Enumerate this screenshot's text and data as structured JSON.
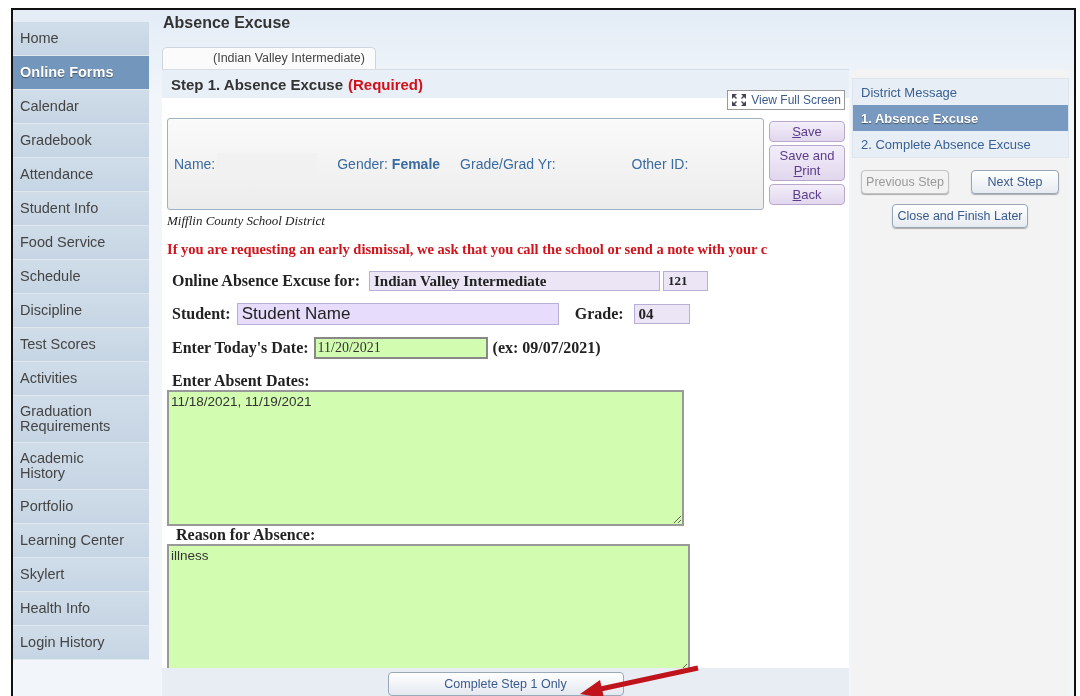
{
  "sidebar": {
    "items": [
      {
        "label": "Home",
        "selected": false
      },
      {
        "label": "Online Forms",
        "selected": true
      },
      {
        "label": "Calendar",
        "selected": false
      },
      {
        "label": "Gradebook",
        "selected": false
      },
      {
        "label": "Attendance",
        "selected": false
      },
      {
        "label": "Student Info",
        "selected": false
      },
      {
        "label": "Food Service",
        "selected": false
      },
      {
        "label": "Schedule",
        "selected": false
      },
      {
        "label": "Discipline",
        "selected": false
      },
      {
        "label": "Test Scores",
        "selected": false
      },
      {
        "label": "Activities",
        "selected": false
      },
      {
        "label": "Graduation Requirements",
        "selected": false
      },
      {
        "label": "Academic History",
        "selected": false
      },
      {
        "label": "Portfolio",
        "selected": false
      },
      {
        "label": "Learning Center",
        "selected": false
      },
      {
        "label": "Skylert",
        "selected": false
      },
      {
        "label": "Health Info",
        "selected": false
      },
      {
        "label": "Login History",
        "selected": false
      }
    ]
  },
  "page_title": "Absence Excuse",
  "tabs": [
    {
      "label": "(Indian Valley Intermediate)",
      "selected": true
    }
  ],
  "step": {
    "title": "Step 1. Absence Excuse",
    "required": "(Required)"
  },
  "view_full_screen": "View Full Screen",
  "student_info": {
    "name_label": "Name:",
    "gender_label": "Gender:",
    "gender": "Female",
    "grade_label": "Grade/Grad Yr:",
    "other_id_label": "Other ID:"
  },
  "actions": [
    {
      "key": "S",
      "after": "ave"
    },
    {
      "before": "Save and ",
      "key": "P",
      "after": "rint"
    },
    {
      "key": "B",
      "after": "ack"
    }
  ],
  "district": "Mifflin County School District",
  "notice": "If you are requesting an early dismissal, we ask that you call the school or send a note with your c",
  "form": {
    "school_label": "Online Absence Excuse for:",
    "school": "Indian Valley Intermediate",
    "school_code": "121",
    "student_label": "Student:",
    "student": "Student Name",
    "grade_label": "Grade:",
    "grade": "04",
    "date_label": "Enter Today's Date:",
    "date": "11/20/2021",
    "date_hint": "(ex: 09/07/2021)",
    "absent_label": "Enter Absent Dates:",
    "absent_dates": "11/18/2021, 11/19/2021",
    "reason_label": "Reason for Absence:",
    "reason": "illness"
  },
  "complete_button": "Complete Step 1 Only",
  "steps_panel": {
    "items": [
      {
        "label": "District Message",
        "selected": false
      },
      {
        "label": "1. Absence Excuse",
        "selected": true
      },
      {
        "label": "2. Complete Absence Excuse",
        "selected": false
      }
    ],
    "nav_buttons": [
      {
        "label": "Previous Step",
        "disabled": true
      },
      {
        "label": "Next Step",
        "disabled": false
      }
    ],
    "close_button": "Close and Finish Later"
  }
}
